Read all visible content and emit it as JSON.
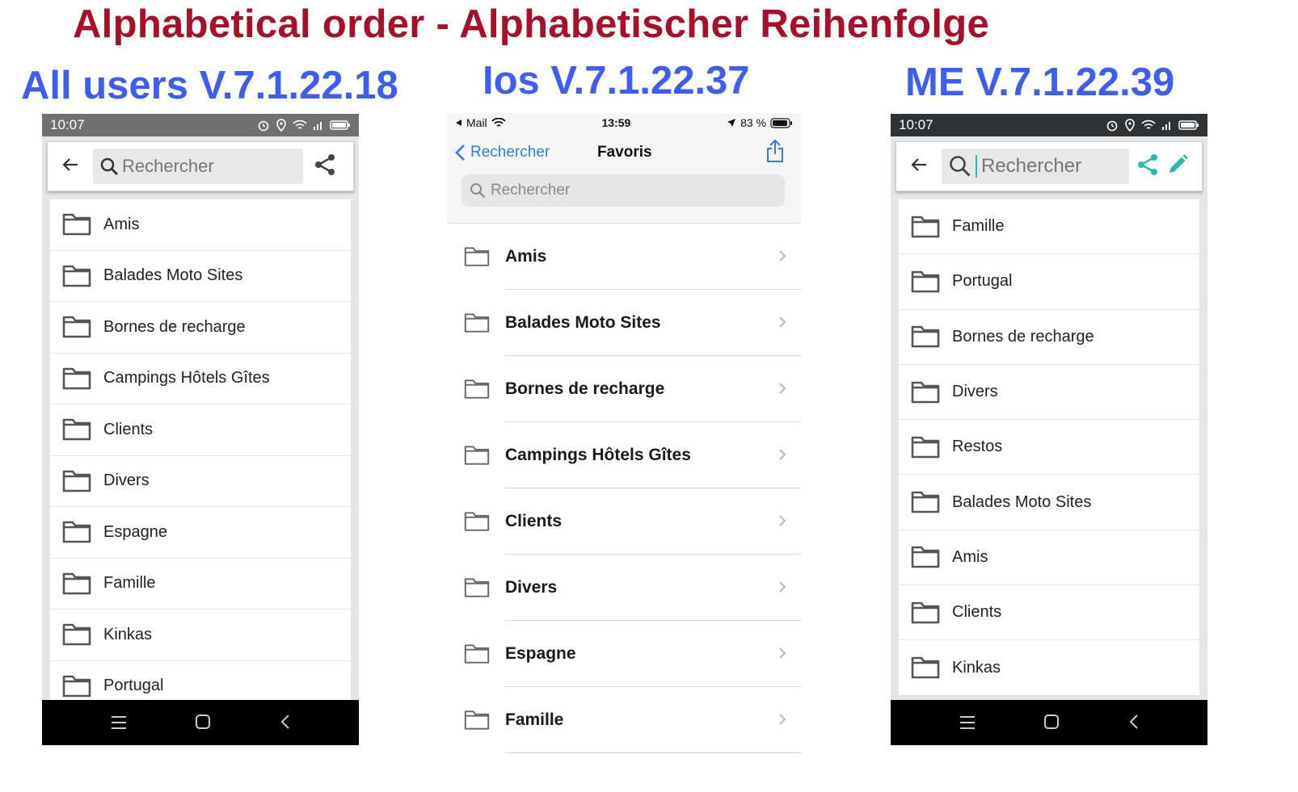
{
  "main_title": "Alphabetical order - Alphabetischer Reihenfolge",
  "columns": {
    "android_all": {
      "title": "All users V.7.1.22.18"
    },
    "ios": {
      "title": "Ios V.7.1.22.37"
    },
    "android_me": {
      "title": "ME V.7.1.22.39"
    }
  },
  "phone1": {
    "status_time": "10:07",
    "search_placeholder": "Rechercher",
    "items": [
      "Amis",
      "Balades Moto Sites",
      "Bornes de recharge",
      "Campings Hôtels Gîtes",
      "Clients",
      "Divers",
      "Espagne",
      "Famille",
      "Kinkas",
      "Portugal"
    ]
  },
  "phone2": {
    "status_carrier": "Mail",
    "status_time": "13:59",
    "status_battery": "83 %",
    "back_label": "Rechercher",
    "nav_title": "Favoris",
    "search_placeholder": "Rechercher",
    "items": [
      "Amis",
      "Balades Moto Sites",
      "Bornes de recharge",
      "Campings Hôtels Gîtes",
      "Clients",
      "Divers",
      "Espagne",
      "Famille"
    ]
  },
  "phone3": {
    "status_time": "10:07",
    "search_placeholder": "Rechercher",
    "accent_color": "#2bbbad",
    "items": [
      "Famille",
      "Portugal",
      "Bornes de recharge",
      "Divers",
      "Restos",
      "Balades Moto Sites",
      "Amis",
      "Clients",
      "Kinkas"
    ]
  },
  "icons": {
    "back": "arrow-left-icon",
    "search": "search-icon",
    "share": "share-icon",
    "edit": "pencil-icon",
    "folder": "folder-icon",
    "chevron": "chevron-right-icon",
    "nav_menu": "menu-icon",
    "nav_home": "home-icon",
    "nav_back": "back-icon"
  }
}
